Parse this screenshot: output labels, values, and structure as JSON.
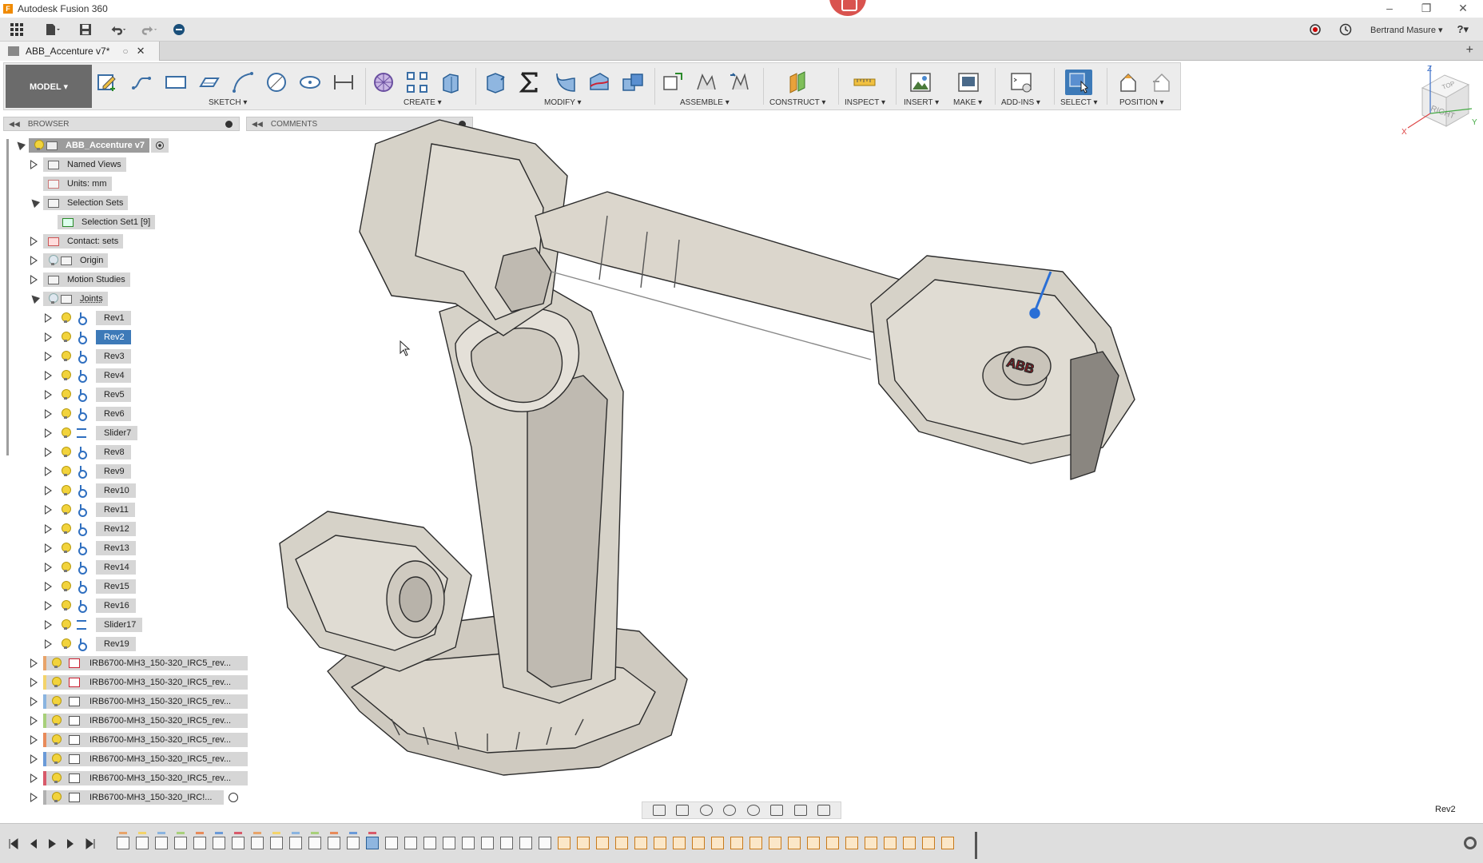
{
  "window": {
    "title": "Autodesk Fusion 360",
    "minimize": "–",
    "restore": "❐",
    "close": "✕"
  },
  "appbar": {
    "user_name": "Bertrand Masure ▾",
    "help_label": "?▾"
  },
  "document_tab": {
    "title": "ABB_Accenture v7*",
    "dot": "○",
    "close": "✕",
    "new_tab": "+"
  },
  "ribbon": {
    "workspace": "MODEL ▾",
    "groups": [
      {
        "id": "sketch",
        "label": "SKETCH ▾"
      },
      {
        "id": "create",
        "label": "CREATE ▾"
      },
      {
        "id": "modify",
        "label": "MODIFY ▾"
      },
      {
        "id": "assemble",
        "label": "ASSEMBLE ▾"
      },
      {
        "id": "construct",
        "label": "CONSTRUCT ▾"
      },
      {
        "id": "inspect",
        "label": "INSPECT ▾"
      },
      {
        "id": "insert",
        "label": "INSERT ▾"
      },
      {
        "id": "make",
        "label": "MAKE ▾"
      },
      {
        "id": "addins",
        "label": "ADD-INS ▾"
      },
      {
        "id": "select",
        "label": "SELECT ▾"
      },
      {
        "id": "position",
        "label": "POSITION ▾"
      }
    ]
  },
  "viewcube": {
    "face": "RIGHT",
    "top": "TOP",
    "axis_x": "X",
    "axis_y": "Y",
    "axis_z": "Z"
  },
  "browser": {
    "title": "BROWSER",
    "collapse_icon": "◀◀",
    "root": "ABB_Accenture v7",
    "folders": {
      "named_views": "Named Views",
      "units": "Units: mm",
      "selection_sets": "Selection Sets",
      "selection_set1": "Selection Set1 [9]",
      "contact_sets": "Contact: sets",
      "origin": "Origin",
      "motion_studies": "Motion Studies",
      "joints": "Joints"
    },
    "joints": [
      "Rev1",
      "Rev2",
      "Rev3",
      "Rev4",
      "Rev5",
      "Rev6",
      "Slider7",
      "Rev8",
      "Rev9",
      "Rev10",
      "Rev11",
      "Rev12",
      "Rev13",
      "Rev14",
      "Rev15",
      "Rev16",
      "Slider17",
      "Rev19"
    ],
    "selected_joint": "Rev2",
    "components": [
      {
        "label": "IRB6700-MH3_150-320_IRC5_rev...",
        "color": "#e8a46a"
      },
      {
        "label": "IRB6700-MH3_150-320_IRC5_rev...",
        "color": "#f3d36a"
      },
      {
        "label": "IRB6700-MH3_150-320_IRC5_rev...",
        "color": "#8ab4e0"
      },
      {
        "label": "IRB6700-MH3_150-320_IRC5_rev...",
        "color": "#a8d07a"
      },
      {
        "label": "IRB6700-MH3_150-320_IRC5_rev...",
        "color": "#e88a5a"
      },
      {
        "label": "IRB6700-MH3_150-320_IRC5_rev...",
        "color": "#6a9ad8"
      },
      {
        "label": "IRB6700-MH3_150-320_IRC5_rev...",
        "color": "#d85a6a"
      },
      {
        "label": "IRB6700-MH3_150-320_IRC!...",
        "color": "#b0b0b0"
      }
    ]
  },
  "comments": {
    "title": "COMMENTS",
    "collapse_icon": "◀◀"
  },
  "viewport": {
    "brand_text": "ABB",
    "status": "Rev2"
  },
  "colors": {
    "accent": "#3d7ab8",
    "panel": "#d6d6d6",
    "ribbon": "#ececec",
    "model_body": "#d6d2c8"
  }
}
